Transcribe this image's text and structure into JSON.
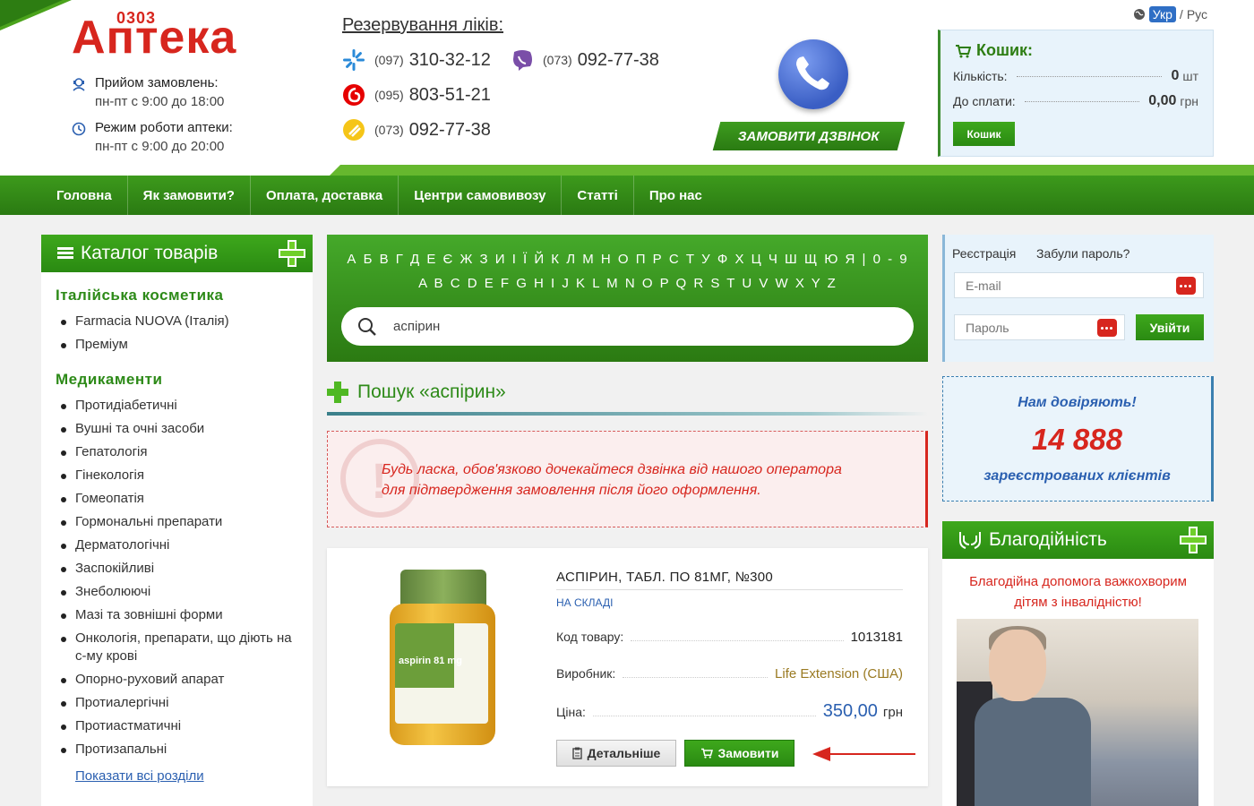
{
  "logo": {
    "small": "0303",
    "main": "Аптека"
  },
  "hours": [
    {
      "title": "Прийом замовлень:",
      "sub": "пн-пт с 9:00 до 18:00"
    },
    {
      "title": "Режим роботи аптеки:",
      "sub": "пн-пт с 9:00 до 20:00"
    }
  ],
  "reserve": {
    "title": "Резервування ліків:",
    "phones": [
      {
        "code": "(097)",
        "number": "310-32-12",
        "icon": "kyivstar-icon"
      },
      {
        "code": "(073)",
        "number": "092-77-38",
        "icon": "viber-icon"
      },
      {
        "code": "(095)",
        "number": "803-51-21",
        "icon": "vodafone-icon"
      },
      {
        "code": "(073)",
        "number": "092-77-38",
        "icon": "lifecell-icon"
      }
    ]
  },
  "call_button": "ЗАМОВИТИ ДЗВІНОК",
  "lang": {
    "active": "Укр",
    "sep": "/",
    "other": "Рус"
  },
  "cart": {
    "title": "Кошик:",
    "qty_label": "Кількість:",
    "qty_value": "0",
    "qty_unit": "шт",
    "sum_label": "До сплати:",
    "sum_value": "0,00",
    "sum_unit": "грн",
    "button": "Кошик"
  },
  "nav": [
    "Головна",
    "Як замовити?",
    "Оплата, доставка",
    "Центри самовивозу",
    "Статті",
    "Про нас"
  ],
  "catalog": {
    "title": "Каталог товарів",
    "sections": [
      {
        "title": "Італійська косметика",
        "items": [
          "Farmacia NUOVA (Італія)",
          "Преміум"
        ]
      },
      {
        "title": "Медикаменти",
        "items": [
          "Протидіабетичні",
          "Вушні та очні засоби",
          "Гепатологія",
          "Гінекологія",
          "Гомеопатія",
          "Гормональні препарати",
          "Дерматологічні",
          "Заспокійливі",
          "Знеболюючі",
          "Мазі та зовнішні форми",
          "Онкологія, препарати, що діють на с-му крові",
          "Опорно-руховий апарат",
          "Протиалергічні",
          "Протиастматичні",
          "Протизапальні"
        ]
      }
    ],
    "show_all": "Показати всі розділи"
  },
  "search": {
    "alphabet_ua": "А Б В Г Д Е Є Ж З И І Ї Й К Л М Н О П Р С Т У Ф Х Ц Ч Ш Щ Ю Я | 0 - 9",
    "alphabet_en": "A B C D E F G H I J K L M N O P Q R S T U V W X Y Z",
    "value": "аспірин",
    "result_title": "Пошук «аспірин»"
  },
  "warning": {
    "line1": "Будь ласка, обов'язково дочекайтеся дзвінка від нашого оператора",
    "line2": "для підтвердження замовлення після його оформлення."
  },
  "product": {
    "title": "АСПІРИН, ТАБЛ. ПО 81МГ, №300",
    "stock": "НА СКЛАДІ",
    "code_label": "Код товару:",
    "code_value": "1013181",
    "maker_label": "Виробник:",
    "maker_value": "Life Extension (США)",
    "price_label": "Ціна:",
    "price_value": "350,00",
    "price_unit": "грн",
    "details_button": "Детальніше",
    "order_button": "Замовити",
    "image_label": "aspirin 81 mg"
  },
  "login": {
    "register": "Реєстрація",
    "forgot": "Забули пароль?",
    "email_placeholder": "E-mail",
    "password_placeholder": "Пароль",
    "button": "Увійти"
  },
  "trust": {
    "line1": "Нам довіряють!",
    "count": "14 888",
    "line3": "зареєстрованих клієнтів"
  },
  "charity": {
    "title": "Благодійність",
    "line1": "Благодійна допомога важкохворим",
    "line2": "дітям з інвалідністю!"
  },
  "colors": {
    "brand_green": "#2d8a18",
    "brand_red": "#d7261e",
    "link_blue": "#2a5fb0"
  }
}
